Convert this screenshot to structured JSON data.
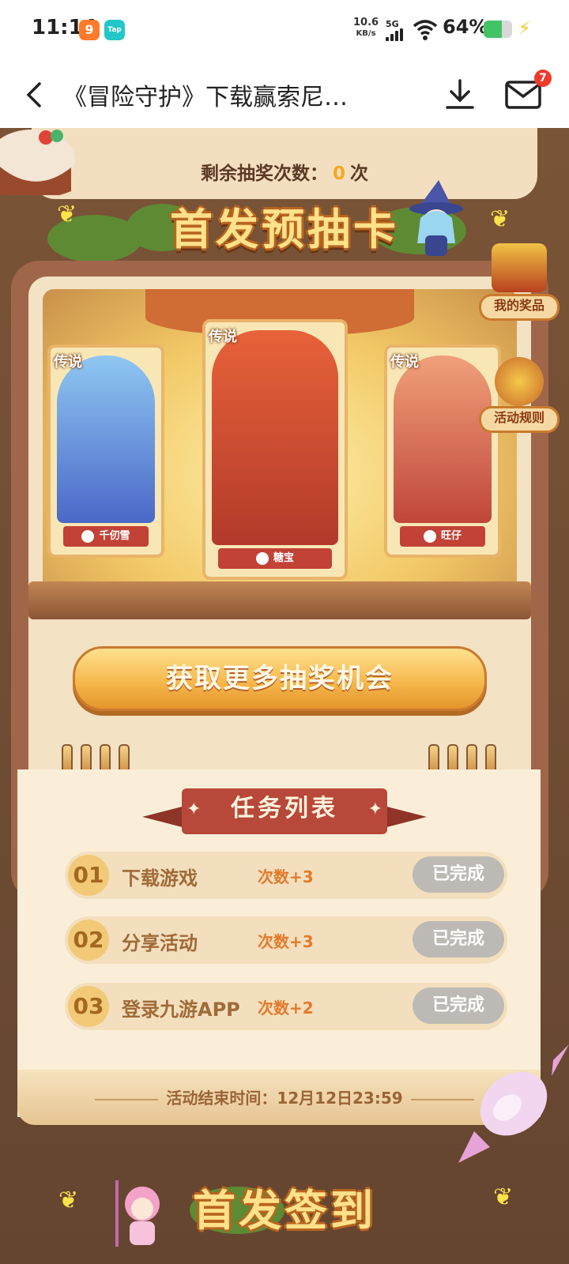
{
  "status_bar": {
    "time": "11:14",
    "app_icon_1": "9",
    "app_icon_2": "Tap",
    "net_speed": "10.6",
    "net_unit": "KB/s",
    "signal_type": "5G",
    "battery_pct": "64%",
    "battery_level": 0.64
  },
  "nav": {
    "title": "《冒险守护》下载赢索尼…",
    "mail_badge": "7"
  },
  "draw": {
    "remaining_prefix": "剩余抽奖次数：",
    "remaining_count": "0",
    "remaining_suffix": "次",
    "title": "首发预抽卡",
    "cards": [
      {
        "tag": "传说",
        "name": "千仞雪"
      },
      {
        "tag": "传说",
        "name": "糖宝"
      },
      {
        "tag": "传说",
        "name": "旺仔"
      }
    ],
    "my_prizes_label": "我的奖品",
    "rules_label": "活动规则",
    "more_chances_label": "获取更多抽奖机会"
  },
  "tasks": {
    "header": "任务列表",
    "items": [
      {
        "no": "01",
        "label": "下载游戏",
        "reward": "次数+3",
        "status": "已完成"
      },
      {
        "no": "02",
        "label": "分享活动",
        "reward": "次数+3",
        "status": "已完成"
      },
      {
        "no": "03",
        "label": "登录九游APP",
        "reward": "次数+2",
        "status": "已完成"
      }
    ],
    "end_time": "活动结束时间：12月12日23:59"
  },
  "signin": {
    "title": "首发签到"
  },
  "colors": {
    "accent": "#f6a821",
    "ribbon": "#b8483a",
    "done_button": "#bdbab5",
    "battery": "#42c466"
  }
}
